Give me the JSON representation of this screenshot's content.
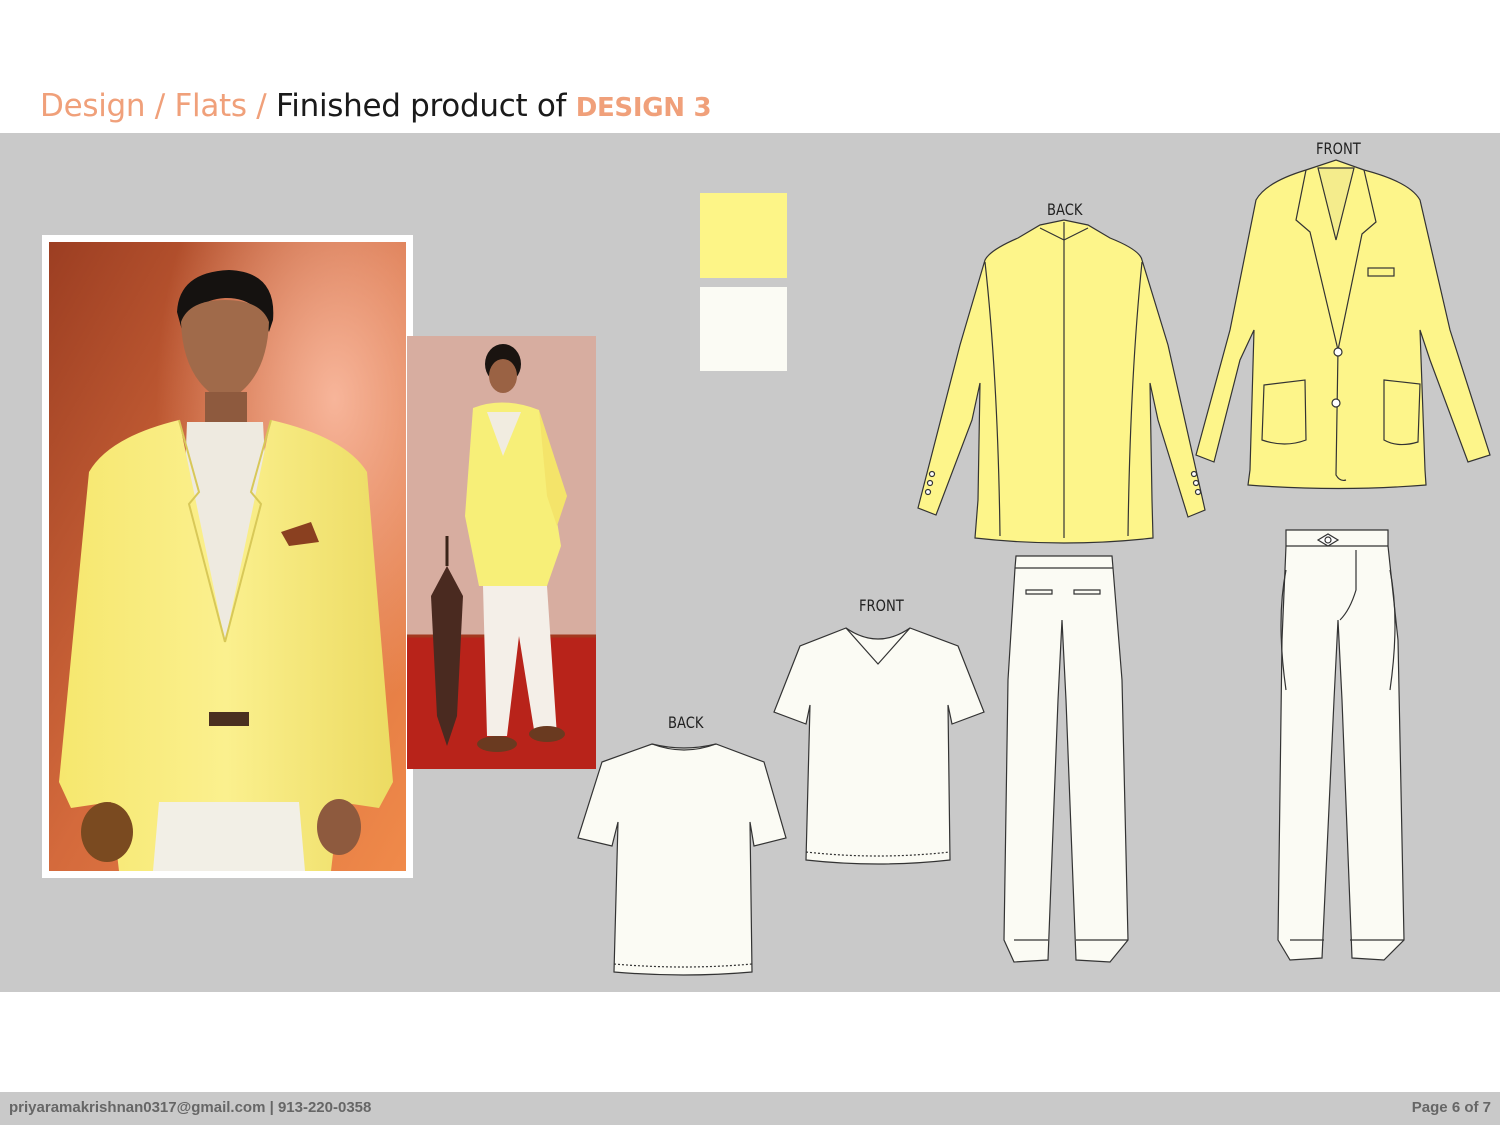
{
  "header": {
    "crumb_design": "Design",
    "sep1": " / ",
    "crumb_flats": "Flats",
    "sep2": " / ",
    "title_text": "Finished product of ",
    "design_label": "DESIGN 3"
  },
  "swatches": [
    {
      "name": "yellow",
      "color": "#fdf587"
    },
    {
      "name": "off-white",
      "color": "#fbfbf4"
    }
  ],
  "flats": {
    "jacket_back_label": "BACK",
    "jacket_front_label": "FRONT",
    "tshirt_front_label": "FRONT",
    "tshirt_back_label": "BACK"
  },
  "footer": {
    "contact": "priyaramakrishnan0317@gmail.com |  913-220-0358",
    "page": "Page 6 of 7"
  }
}
